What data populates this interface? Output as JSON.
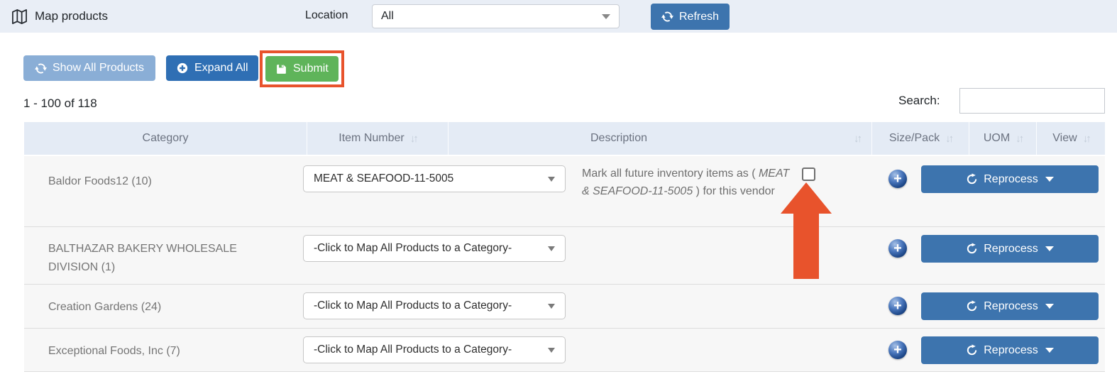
{
  "topbar": {
    "title": "Map products",
    "location_label": "Location",
    "location_value": "All",
    "refresh_label": "Refresh"
  },
  "toolbar": {
    "show_all_label": "Show All Products",
    "expand_all_label": "Expand All",
    "submit_label": "Submit"
  },
  "pagination": "1 - 100 of 118",
  "search": {
    "label": "Search:",
    "value": ""
  },
  "table": {
    "headers": [
      "Category",
      "Item Number",
      "Description",
      "Size/Pack",
      "UOM",
      "View"
    ],
    "reprocess_label": "Reprocess",
    "rows": [
      {
        "category": "Baldor Foods12 (10)",
        "category_select": "MEAT & SEAFOOD-11-5005",
        "desc_prefix": "Mark all future inventory items as ( ",
        "desc_italic": "MEAT & SEAFOOD-11-5005",
        "desc_suffix": " ) for this vendor"
      },
      {
        "category": "BALTHAZAR BAKERY WHOLESALE DIVISION (1)",
        "category_select": "-Click to Map All Products to a Category-"
      },
      {
        "category": "Creation Gardens (24)",
        "category_select": "-Click to Map All Products to a Category-"
      },
      {
        "category": "Exceptional Foods, Inc (7)",
        "category_select": "-Click to Map All Products to a Category-"
      }
    ]
  },
  "glyphs": {
    "sort": "↓↑",
    "plus": "+"
  },
  "colors": {
    "primary_blue": "#3d74ae",
    "light_blue": "#8aaed6",
    "green": "#5fb45a",
    "highlight_orange": "#e8532c",
    "header_bg": "#e4ebf5",
    "topbar_bg": "#e9eef6"
  }
}
